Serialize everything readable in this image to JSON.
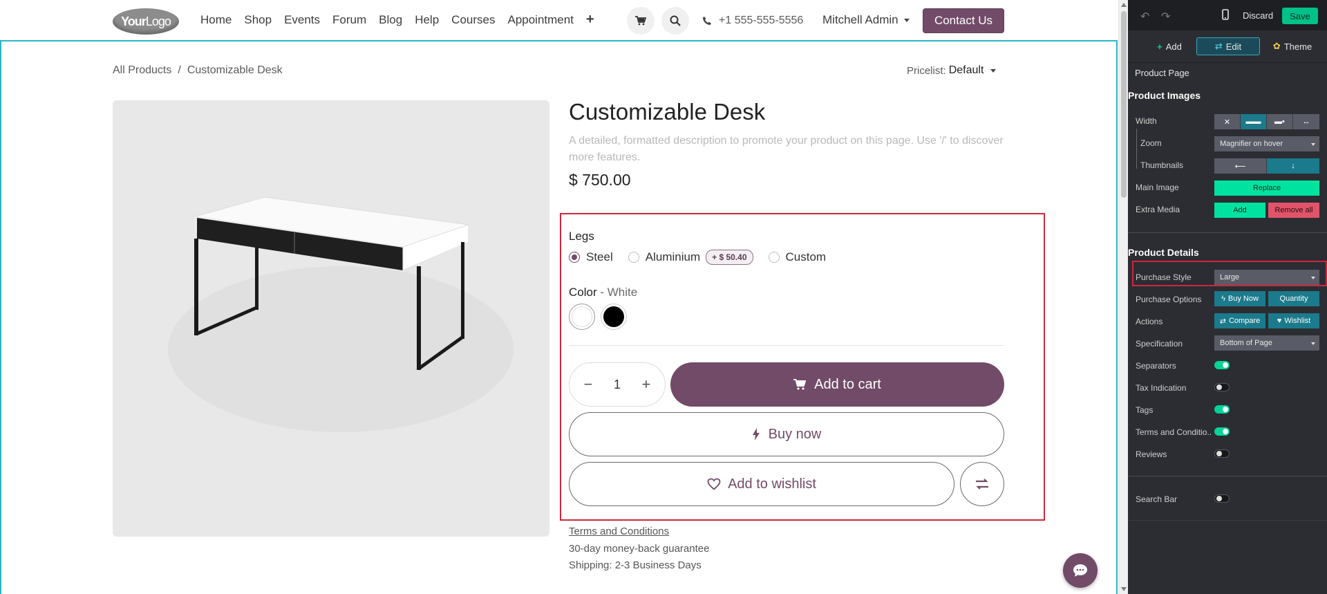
{
  "header": {
    "logo_text_bold": "Your",
    "logo_text_thin": "Logo",
    "nav": [
      "Home",
      "Shop",
      "Events",
      "Forum",
      "Blog",
      "Help",
      "Courses",
      "Appointment"
    ],
    "phone": "+1 555-555-5556",
    "user": "Mitchell Admin",
    "contact_label": "Contact Us"
  },
  "breadcrumb": {
    "parent": "All Products",
    "separator": "/",
    "current": "Customizable Desk"
  },
  "pricelist": {
    "label": "Pricelist:",
    "value": "Default"
  },
  "product": {
    "title": "Customizable Desk",
    "description_placeholder": "A detailed, formatted description to promote your product on this page. Use '/' to discover more features.",
    "price": "$ 750.00",
    "legs_label": "Legs",
    "legs_options": [
      {
        "label": "Steel",
        "checked": true
      },
      {
        "label": "Aluminium",
        "extra": "+ $ 50.40"
      },
      {
        "label": "Custom"
      }
    ],
    "color_label": "Color",
    "color_value": " - White",
    "swatches": [
      {
        "name": "White",
        "color": "#ffffff",
        "selected": true
      },
      {
        "name": "Black",
        "color": "#000000"
      }
    ],
    "quantity": "1",
    "add_to_cart": "Add to cart",
    "buy_now": "Buy now",
    "add_to_wishlist": "Add to wishlist",
    "terms": "Terms and Conditions",
    "guarantee": "30-day money-back guarantee",
    "shipping": "Shipping: 2-3 Business Days"
  },
  "editor": {
    "discard": "Discard",
    "save": "Save",
    "tabs": {
      "add": "Add",
      "edit": "Edit",
      "theme": "Theme"
    },
    "section": "Product Page",
    "images_group": "Product Images",
    "width_label": "Width",
    "zoom_label": "Zoom",
    "zoom_value": "Magnifier on hover",
    "thumbnails_label": "Thumbnails",
    "main_image_label": "Main Image",
    "replace": "Replace",
    "extra_media_label": "Extra Media",
    "extra_add": "Add",
    "remove_all": "Remove all",
    "details_group": "Product Details",
    "purchase_style_label": "Purchase Style",
    "purchase_style_value": "Large",
    "purchase_options_label": "Purchase Options",
    "buy_now_opt": "Buy Now",
    "quantity_opt": "Quantity",
    "actions_label": "Actions",
    "compare_opt": "Compare",
    "wishlist_opt": "Wishlist",
    "specification_label": "Specification",
    "specification_value": "Bottom of Page",
    "toggles": [
      {
        "label": "Separators",
        "on": true
      },
      {
        "label": "Tax Indication",
        "on": false
      },
      {
        "label": "Tags",
        "on": true
      },
      {
        "label": "Terms and Conditio...",
        "on": true
      },
      {
        "label": "Reviews",
        "on": false
      }
    ],
    "search_bar_label": "Search Bar",
    "search_bar_on": false
  },
  "colors": {
    "brand": "#714b67",
    "editor_bg": "#2b2d33",
    "accent_teal": "#1b7a8c",
    "selection": "#d0263c",
    "save_green": "#00c288"
  }
}
